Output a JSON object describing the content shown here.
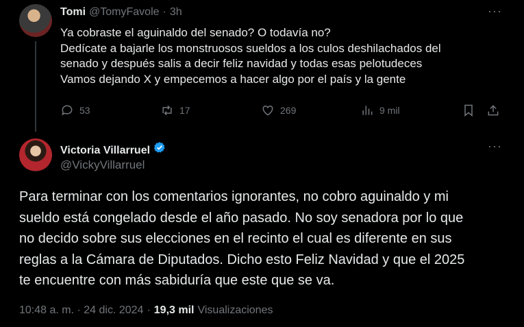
{
  "reply": {
    "author_name": "Tomi",
    "author_handle": "@TomyFavole",
    "separator": "·",
    "time": "3h",
    "text_lines": [
      "Ya cobraste el aguinaldo del senado? O todavía no?",
      "Dedícate a bajarle los monstruosos sueldos a los culos deshilachados del",
      "senado y después salis a decir feliz navidad y todas esas pelotudeces",
      "Vamos dejando X y empecemos a hacer algo por el país y la gente"
    ],
    "replies": "53",
    "reposts": "17",
    "likes": "269",
    "views": "9 mil"
  },
  "main": {
    "author_name": "Victoria Villarruel",
    "author_handle": "@VickyVillarruel",
    "text_lines": [
      "Para terminar con los comentarios ignorantes, no cobro aguinaldo y mi",
      "sueldo está congelado desde el año pasado. No soy senadora por lo que",
      "no decido sobre sus elecciones en el recinto el cual es diferente en sus",
      "reglas a la Cámara de Diputados. Dicho esto Feliz Navidad y que el 2025",
      "te encuentre con más sabiduría que este que se va."
    ],
    "timestamp": "10:48 a. m. · 24 dic. 2024",
    "separator": "·",
    "views_count": "19,3 mil",
    "views_label": "Visualizaciones"
  },
  "more_glyph": "···",
  "colors": {
    "background": "#000000",
    "text": "#e7e9ea",
    "muted": "#71767b",
    "verified": "#1d9bf0"
  }
}
